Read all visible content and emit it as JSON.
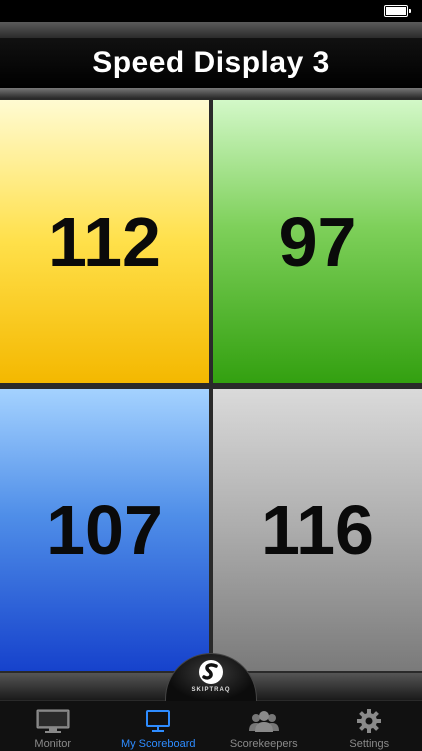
{
  "window": {
    "title": "Speed Display 3"
  },
  "tiles": [
    {
      "value": "112",
      "color": "#ffe04a"
    },
    {
      "value": "97",
      "color": "#5ab535"
    },
    {
      "value": "107",
      "color": "#3a78e0"
    },
    {
      "value": "116",
      "color": "#acacac"
    }
  ],
  "logo": {
    "text": "SKIPTRAQ"
  },
  "tabs": [
    {
      "label": "Monitor",
      "icon": "monitor-icon"
    },
    {
      "label": "My Scoreboard",
      "icon": "scoreboard-icon",
      "active": true
    },
    {
      "label": "Scorekeepers",
      "icon": "scorekeepers-icon"
    },
    {
      "label": "Settings",
      "icon": "gear-icon"
    }
  ],
  "colors": {
    "accent": "#2e8cff",
    "tab_inactive": "#8a8a8a"
  }
}
